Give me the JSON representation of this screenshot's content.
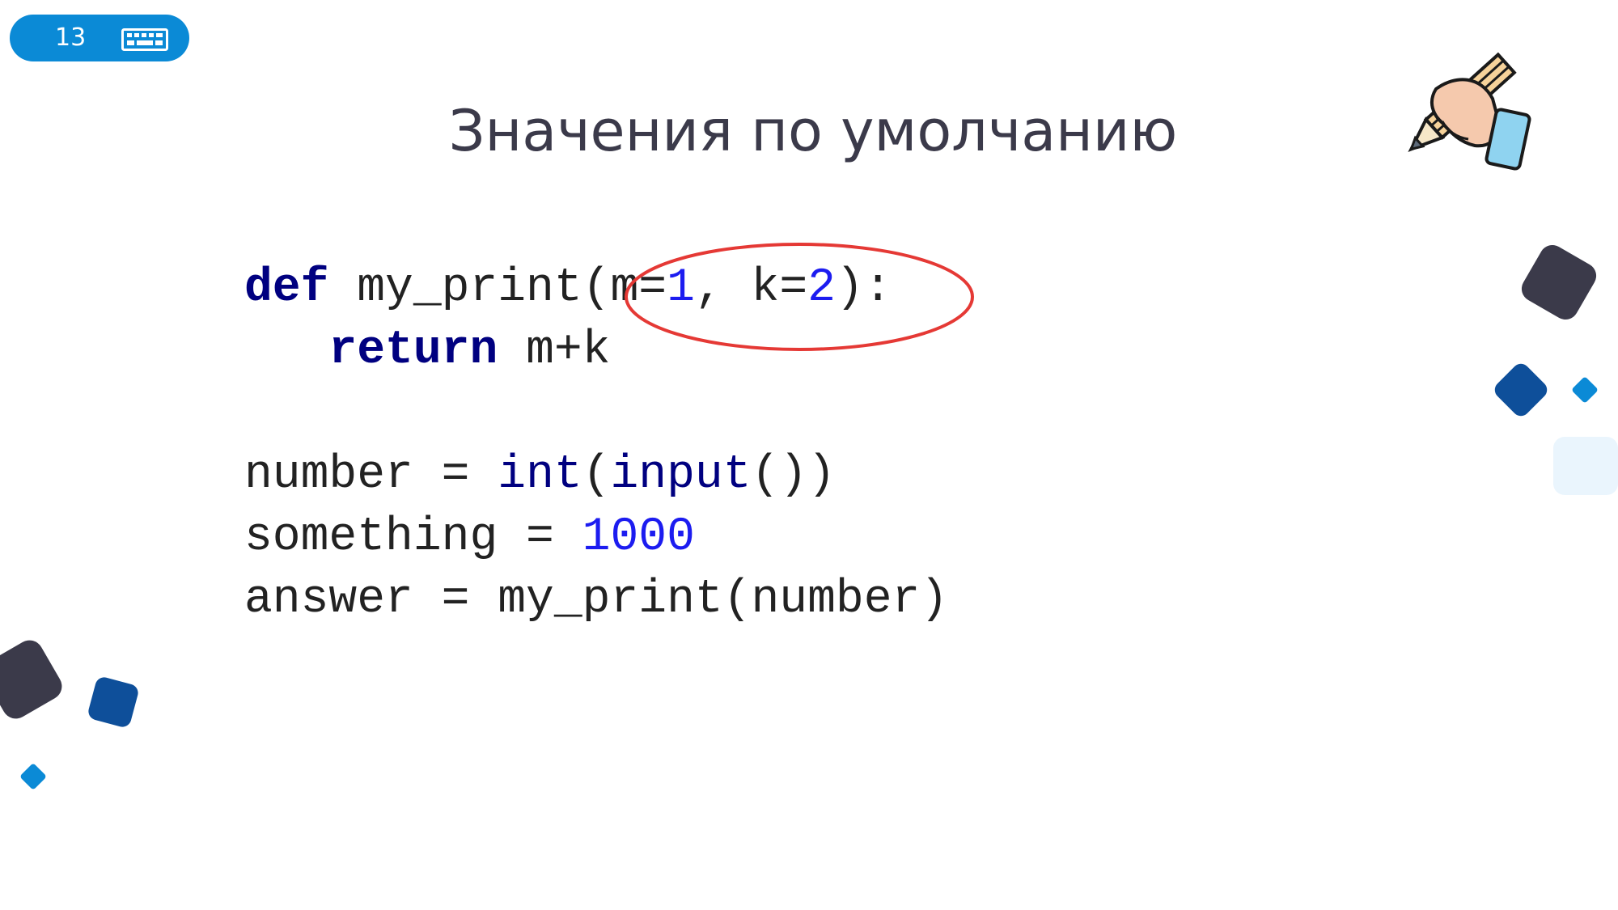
{
  "slide": {
    "number": "13",
    "title": "Значения по умолчанию"
  },
  "code": {
    "line1": {
      "kw": "def",
      "name": " my_print(m=",
      "num1": "1",
      "mid": ", k=",
      "num2": "2",
      "end": "):"
    },
    "line2": {
      "indent": "   ",
      "kw": "return",
      "rest": " m+k"
    },
    "line4": {
      "start": "number = ",
      "b1": "int",
      "p1": "(",
      "b2": "input",
      "end": "())"
    },
    "line5": {
      "start": "something = ",
      "num": "1000"
    },
    "line6": {
      "text": "answer = my_print(number)"
    }
  },
  "icons": [
    "keyboard-icon",
    "hand-writing-icon"
  ],
  "colors": {
    "badge": "#0b8ad6",
    "keyword": "#000080",
    "number": "#1c1cf0",
    "highlight-ellipse": "#e53935",
    "dark-square": "#3b3a4a",
    "navy-square": "#0e4f9a",
    "light-blue-square": "#0b8ad6"
  }
}
